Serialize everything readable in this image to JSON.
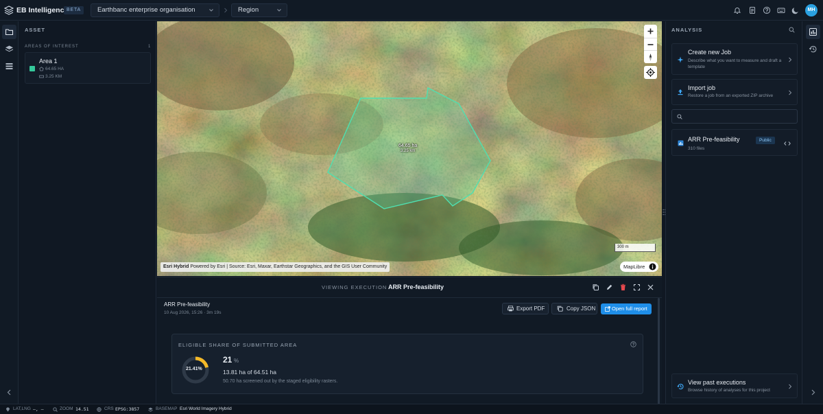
{
  "brand": {
    "name": "EB Intelligence",
    "badge": "BETA"
  },
  "topbar": {
    "organisation": "Earthbanc enterprise organisation",
    "region": "Region",
    "user_initials": "MH"
  },
  "asset_panel": {
    "title": "ASSET",
    "section_title": "AREAS OF INTEREST",
    "section_count": "1",
    "areas": [
      {
        "name": "Area 1",
        "area": "64.65 HA",
        "perimeter": "3.25 KM",
        "color": "#34c89a"
      }
    ]
  },
  "map": {
    "polygon_label_area": "64.65 ha",
    "polygon_label_perimeter": "3.25 km",
    "scale": "300 m",
    "attribution_bold": "Esri Hybrid",
    "attribution": "Powered by Esri | Source: Esri, Maxar, Earthstar Geographics, and the GIS User Community",
    "maplibre": "MapLibre"
  },
  "execution": {
    "header_label": "VIEWING EXECUTION",
    "header_title": "ARR Pre-feasibility",
    "job_name": "ARR Pre-feasibility",
    "job_meta": "10 Aug 2026, 15:26 · 3m 19s",
    "export_pdf": "Export PDF",
    "copy_json": "Copy JSON",
    "open_report": "Open full report",
    "card_title": "ELIGIBLE SHARE OF SUBMITTED AREA",
    "donut_label": "21.41%",
    "donut_fraction": 0.2141,
    "big_value": "21",
    "big_unit": "%",
    "ha_line": "13.81 ha of 64.51 ha",
    "note": "50.70 ha screened out by the staged eligibility rasters."
  },
  "analysis": {
    "title": "ANALYSIS",
    "create_title": "Create new Job",
    "create_sub": "Describe what you want to measure and draft a template",
    "import_title": "Import job",
    "import_sub": "Restore a job from an exported ZIP archive",
    "search_placeholder": "",
    "job_name": "ARR Pre-feasibility",
    "job_badge": "Public",
    "job_files": "310 files",
    "past_title": "View past executions",
    "past_sub": "Browse history of analyses for this project"
  },
  "statusbar": {
    "latlng_label": "LAT,LNG",
    "latlng_value": "–, –",
    "zoom_label": "ZOOM",
    "zoom_value": "14.51",
    "crs_label": "CRS",
    "crs_value": "EPSG:3857",
    "basemap_label": "BASEMAP",
    "basemap_value": "Esri World Imagery Hybrid"
  },
  "colors": {
    "accent": "#1f8ee8",
    "area": "#34c89a",
    "donut": "#f4b928"
  }
}
